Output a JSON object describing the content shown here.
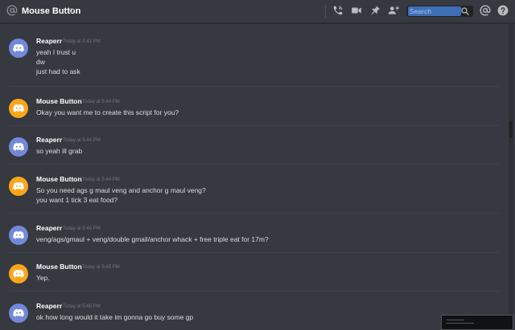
{
  "header": {
    "channel_name": "Mouse Button",
    "search_placeholder": "Search"
  },
  "icons": {
    "at": "at-sign-icon",
    "status": "offline-status-icon",
    "call": "phone-call-icon",
    "video": "video-call-icon",
    "pin": "pin-icon",
    "add_user": "add-friend-icon",
    "search": "search-icon",
    "mentions": "at-mentions-icon",
    "help": "help-icon"
  },
  "colors": {
    "background": "#36393f",
    "avatar_blue": "#7289da",
    "avatar_orange": "#faa61a",
    "search_highlight": "#3e6fb5"
  },
  "messages": [
    {
      "author": "Reaperr",
      "time": "Today at 5:43 PM",
      "avatar": "blue",
      "lines": [
        "yeah I trust u",
        "dw",
        "just had to ask"
      ]
    },
    {
      "author": "Mouse Button",
      "time": "Today at 5:44 PM",
      "avatar": "orange",
      "lines": [
        "Okay you want me to create this script for you?"
      ]
    },
    {
      "author": "Reaperr",
      "time": "Today at 5:44 PM",
      "avatar": "blue",
      "lines": [
        "so yeah ill grab"
      ]
    },
    {
      "author": "Mouse Button",
      "time": "Today at 5:44 PM",
      "avatar": "orange",
      "lines": [
        "So you need ags g maul veng and anchor g maul veng?",
        "you want 1 tick 3 eat food?"
      ]
    },
    {
      "author": "Reaperr",
      "time": "Today at 5:45 PM",
      "avatar": "blue",
      "lines": [
        "veng/ags/gmaul + veng/double gmail/anchor whack + free triple eat for 17m?"
      ]
    },
    {
      "author": "Mouse Button",
      "time": "Today at 5:45 PM",
      "avatar": "orange",
      "lines": [
        "Yep."
      ]
    },
    {
      "author": "Reaperr",
      "time": "Today at 5:45 PM",
      "avatar": "blue",
      "lines": [
        "ok how long would it take im gonna go buy some gp"
      ]
    }
  ]
}
